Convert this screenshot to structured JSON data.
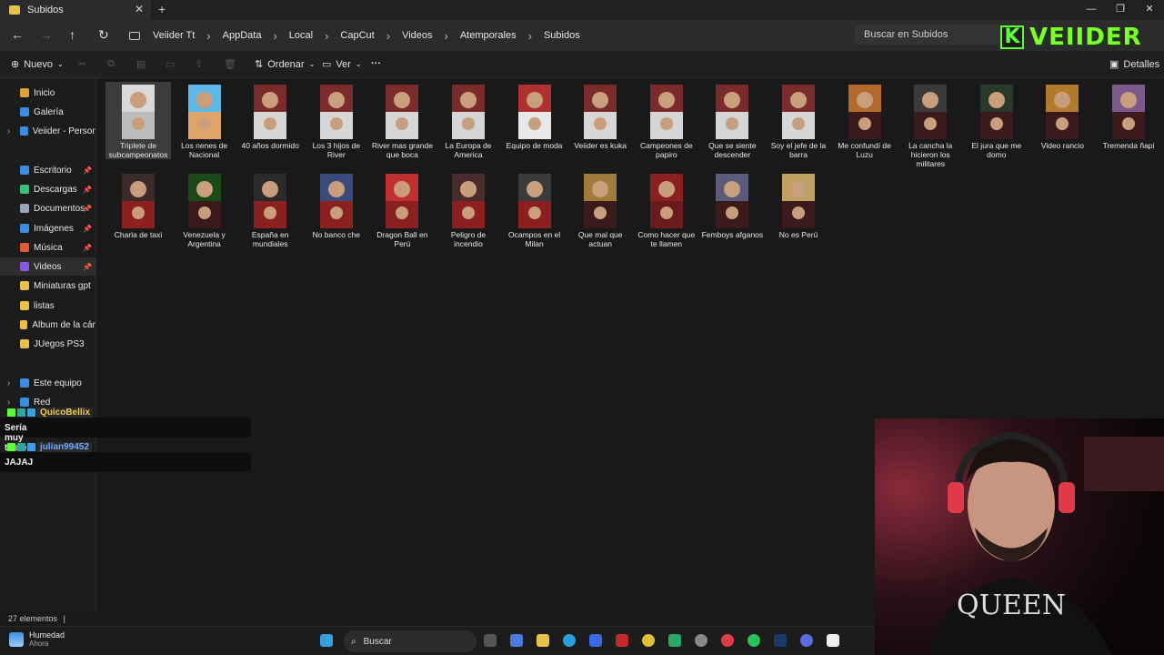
{
  "window": {
    "tab_title": "Subidos",
    "close_tab": "✕",
    "new_tab": "+",
    "controls": [
      "—",
      "❐",
      "✕"
    ]
  },
  "address": {
    "breadcrumbs": [
      "Veiider Tt",
      "AppData",
      "Local",
      "CapCut",
      "Videos",
      "Atemporales",
      "Subidos"
    ],
    "search_placeholder": "Buscar en Subidos"
  },
  "logo": {
    "letter": "K",
    "name": "VEIIDER"
  },
  "toolbar": {
    "new_label": "Nuevo",
    "sort_label": "Ordenar",
    "view_label": "Ver",
    "more_label": "···",
    "details_label": "Detalles"
  },
  "sidebar": {
    "items": [
      {
        "label": "Inicio",
        "icon": "home-icon",
        "color": "#e0a03a"
      },
      {
        "label": "Galería",
        "icon": "gallery-icon",
        "color": "#3a8fe0"
      },
      {
        "label": "Veiider - Personal",
        "icon": "cloud-icon",
        "color": "#3a8fe0"
      },
      {
        "label": "Escritorio",
        "icon": "desktop-icon",
        "color": "#3a8fe0"
      },
      {
        "label": "Descargas",
        "icon": "download-icon",
        "color": "#3ac07a"
      },
      {
        "label": "Documentos",
        "icon": "documents-icon",
        "color": "#9aa7b8"
      },
      {
        "label": "Imágenes",
        "icon": "images-icon",
        "color": "#3a8fe0"
      },
      {
        "label": "Música",
        "icon": "music-icon",
        "color": "#e05a3a"
      },
      {
        "label": "Videos",
        "icon": "videos-icon",
        "color": "#8a5ae0"
      },
      {
        "label": "Miniaturas gpt",
        "icon": "folder-icon",
        "color": "#e8c04a"
      },
      {
        "label": "listas",
        "icon": "folder-icon",
        "color": "#e8c04a"
      },
      {
        "label": "Álbum de la cámar",
        "icon": "folder-icon",
        "color": "#e8c04a"
      },
      {
        "label": "JUegos PS3",
        "icon": "folder-icon",
        "color": "#e8c04a"
      },
      {
        "label": "Este equipo",
        "icon": "computer-icon",
        "color": "#3a8fe0"
      },
      {
        "label": "Red",
        "icon": "network-icon",
        "color": "#3a8fe0"
      }
    ]
  },
  "files": [
    {
      "name": "Triplete de subcampeonatos",
      "top": "#d9d9d9",
      "bot": "#bcbcbc"
    },
    {
      "name": "Los nenes de Nacional",
      "top": "#5fb7e8",
      "bot": "#e0a36a"
    },
    {
      "name": "40 años dormido",
      "top": "#7a2c2c",
      "bot": "#d6d6d6"
    },
    {
      "name": "Los 3 hijos de River",
      "top": "#7a2c2c",
      "bot": "#d6d6d6"
    },
    {
      "name": "River mas grande que boca",
      "top": "#7a2c2c",
      "bot": "#d6d6d6"
    },
    {
      "name": "La Europa de America",
      "top": "#7a2c2c",
      "bot": "#d6d6d6"
    },
    {
      "name": "Equipo de moda",
      "top": "#b03030",
      "bot": "#e8e8e8"
    },
    {
      "name": "Veiider es kuka",
      "top": "#7a2c2c",
      "bot": "#d6d6d6"
    },
    {
      "name": "Campeones de papiro",
      "top": "#7a2c2c",
      "bot": "#d6d6d6"
    },
    {
      "name": "Que se siente descender",
      "top": "#7a2c2c",
      "bot": "#d6d6d6"
    },
    {
      "name": "Soy el jefe de la barra",
      "top": "#7a2c2c",
      "bot": "#d6d6d6"
    },
    {
      "name": "Me confundí de Luzu",
      "top": "#b06a2a",
      "bot": "#3a1a1a"
    },
    {
      "name": "La cancha la hicieron los militares",
      "top": "#3a3a3a",
      "bot": "#3a1a1a"
    },
    {
      "name": "El jura que me domo",
      "top": "#2a3a2a",
      "bot": "#3a1a1a"
    },
    {
      "name": "Video rancio",
      "top": "#b07a2a",
      "bot": "#3a1a1a"
    },
    {
      "name": "Tremenda ñapi",
      "top": "#7a5a8a",
      "bot": "#3a1a1a"
    },
    {
      "name": "Charla de taxi",
      "top": "#3a2a2a",
      "bot": "#8a2020"
    },
    {
      "name": "Venezuela y Argentina",
      "top": "#1a4a1a",
      "bot": "#3a1a1a"
    },
    {
      "name": "España en mundiales",
      "top": "#2a2a2a",
      "bot": "#8a2020"
    },
    {
      "name": "No banco che",
      "top": "#3a4a7a",
      "bot": "#8a2020"
    },
    {
      "name": "Dragon Ball en Perú",
      "top": "#c03030",
      "bot": "#8a2020"
    },
    {
      "name": "Peligro de incendio",
      "top": "#4a2a2a",
      "bot": "#8a2020"
    },
    {
      "name": "Ocampos en el Milan",
      "top": "#3a3a3a",
      "bot": "#8a2020"
    },
    {
      "name": "Que mal que actuan",
      "top": "#a07a3a",
      "bot": "#3a1a1a"
    },
    {
      "name": "Como hacer que te llamen",
      "top": "#8a2020",
      "bot": "#6a1a1a"
    },
    {
      "name": "Femboys afganos",
      "top": "#5a5a7a",
      "bot": "#3a1a1a"
    },
    {
      "name": "No es Perú",
      "top": "#c0a060",
      "bot": "#3a1a1a"
    }
  ],
  "chat": [
    {
      "user": "QuicoBellix",
      "user_color": "#f2c94c",
      "message": "Sería muy triste"
    },
    {
      "user": "julian99452",
      "user_color": "#6fa8ff",
      "message": "JAJAJ"
    }
  ],
  "status": {
    "count": "27 elementos",
    "separator": "|"
  },
  "taskbar": {
    "weather_title": "Humedad",
    "weather_sub": "Ahora",
    "search_label": "Buscar"
  },
  "webcam": {
    "shirt_text": "QUEEN"
  }
}
